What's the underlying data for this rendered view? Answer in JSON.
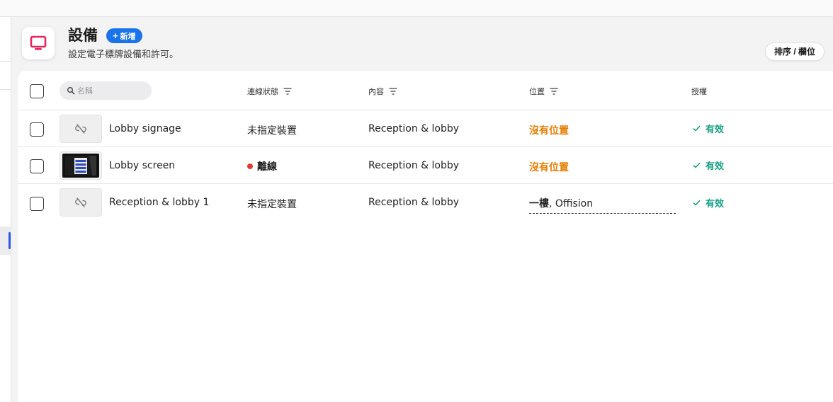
{
  "header": {
    "title": "設備",
    "add_label": "新增",
    "add_plus": "+",
    "subtitle": "設定電子標牌設備和許可。",
    "sort_label": "排序 / 欄位"
  },
  "table": {
    "search_placeholder": "名稱",
    "columns": {
      "connection": "連線狀態",
      "content": "內容",
      "location": "位置",
      "license": "授權"
    },
    "rows": [
      {
        "name": "Lobby signage",
        "status": "未指定裝置",
        "content": "Reception & lobby",
        "location": "沒有位置",
        "license": "有效"
      },
      {
        "name": "Lobby screen",
        "status": "離線",
        "content": "Reception & lobby",
        "location": "沒有位置",
        "license": "有效"
      },
      {
        "name": "Reception & lobby 1",
        "status": "未指定裝置",
        "content": "Reception & lobby",
        "location_floor": "一樓",
        "location_rest": ", Offision",
        "license": "有效"
      }
    ]
  },
  "colors": {
    "accent": "#1a73e8",
    "brand_icon": "#e8265e",
    "no_location": "#e67e00",
    "license_valid": "#13a085",
    "offline_dot": "#e53935"
  }
}
